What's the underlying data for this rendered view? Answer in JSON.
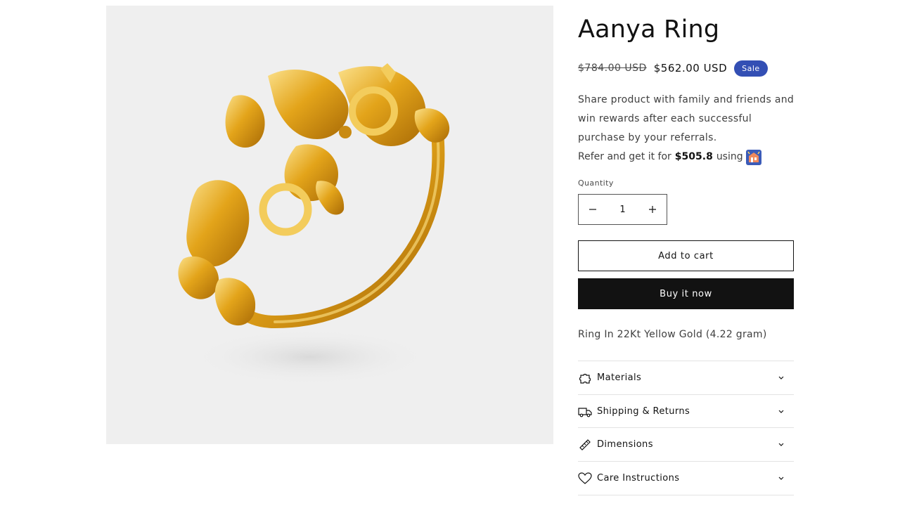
{
  "product": {
    "title": "Aanya Ring",
    "price_original": "$784.00 USD",
    "price_sale": "$562.00 USD",
    "badge": "Sale",
    "image_icon": "gold-ring-photo",
    "share_text": "Share product with family and friends and win rewards after each successful purchase by your referrals.",
    "refer_prefix": "Refer and get it for",
    "refer_price": "$505.8",
    "refer_suffix": "using",
    "refer_logo_icon": "referral-app-logo-icon",
    "quantity_label": "Quantity",
    "quantity_value": "1",
    "decrease_icon": "minus-icon",
    "increase_icon": "plus-icon",
    "add_to_cart": "Add to cart",
    "buy_now": "Buy it now",
    "description": "Ring In 22Kt Yellow Gold (4.22 gram)"
  },
  "accordion": [
    {
      "label": "Materials",
      "icon": "puzzle-icon"
    },
    {
      "label": "Shipping & Returns",
      "icon": "truck-icon"
    },
    {
      "label": "Dimensions",
      "icon": "ruler-icon"
    },
    {
      "label": "Care Instructions",
      "icon": "heart-icon"
    }
  ],
  "colors": {
    "badge_bg": "#334fb4",
    "buy_button_bg": "#121212",
    "gold": "#e3a41a",
    "media_bg": "#efefef"
  }
}
